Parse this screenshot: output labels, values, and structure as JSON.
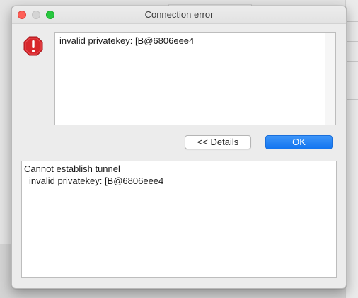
{
  "window": {
    "title": "Connection error"
  },
  "message": {
    "text": "invalid privatekey: [B@6806eee4",
    "icon": "error-octagon-icon"
  },
  "buttons": {
    "details_label": "<< Details",
    "ok_label": "OK"
  },
  "details": {
    "lines": [
      "Cannot establish tunnel",
      "invalid privatekey: [B@6806eee4"
    ]
  },
  "colors": {
    "accent": "#1375f0",
    "error_icon": "#d8262b",
    "close": "#fe5f57",
    "maximize": "#28c840"
  }
}
